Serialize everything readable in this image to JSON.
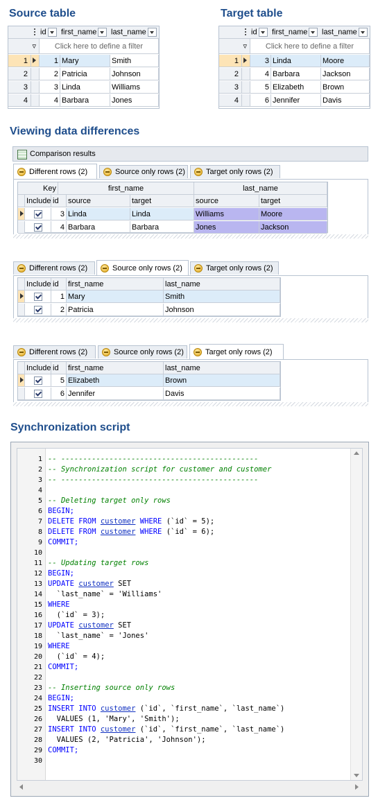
{
  "source_section": {
    "title": "Source table",
    "columns": [
      "id",
      "first_name",
      "last_name"
    ],
    "filter_text": "Click here to define a filter",
    "rows": [
      {
        "row": "1",
        "id": "1",
        "first_name": "Mary",
        "last_name": "Smith"
      },
      {
        "row": "2",
        "id": "2",
        "first_name": "Patricia",
        "last_name": "Johnson"
      },
      {
        "row": "3",
        "id": "3",
        "first_name": "Linda",
        "last_name": "Williams"
      },
      {
        "row": "4",
        "id": "4",
        "first_name": "Barbara",
        "last_name": "Jones"
      }
    ]
  },
  "target_section": {
    "title": "Target table",
    "columns": [
      "id",
      "first_name",
      "last_name"
    ],
    "filter_text": "Click here to define a filter",
    "rows": [
      {
        "row": "1",
        "id": "3",
        "first_name": "Linda",
        "last_name": "Moore"
      },
      {
        "row": "2",
        "id": "4",
        "first_name": "Barbara",
        "last_name": "Jackson"
      },
      {
        "row": "3",
        "id": "5",
        "first_name": "Elizabeth",
        "last_name": "Brown"
      },
      {
        "row": "4",
        "id": "6",
        "first_name": "Jennifer",
        "last_name": "Davis"
      }
    ]
  },
  "diff_section": {
    "title": "Viewing data differences",
    "panel_title": "Comparison results",
    "tabs": [
      "Different rows (2)",
      "Source only rows (2)",
      "Target only rows (2)"
    ],
    "different": {
      "group_headers": {
        "key": "Key",
        "first_name": "first_name",
        "last_name": "last_name"
      },
      "sub_headers": {
        "include": "Include",
        "id": "id",
        "source": "source",
        "target": "target"
      },
      "rows": [
        {
          "id": "3",
          "fn_source": "Linda",
          "fn_target": "Linda",
          "ln_source": "Williams",
          "ln_target": "Moore"
        },
        {
          "id": "4",
          "fn_source": "Barbara",
          "fn_target": "Barbara",
          "ln_source": "Jones",
          "ln_target": "Jackson"
        }
      ]
    },
    "source_only": {
      "headers": {
        "include": "Include",
        "id": "id",
        "first_name": "first_name",
        "last_name": "last_name"
      },
      "rows": [
        {
          "id": "1",
          "first_name": "Mary",
          "last_name": "Smith"
        },
        {
          "id": "2",
          "first_name": "Patricia",
          "last_name": "Johnson"
        }
      ]
    },
    "target_only": {
      "headers": {
        "include": "Include",
        "id": "id",
        "first_name": "first_name",
        "last_name": "last_name"
      },
      "rows": [
        {
          "id": "5",
          "first_name": "Elizabeth",
          "last_name": "Brown"
        },
        {
          "id": "6",
          "first_name": "Jennifer",
          "last_name": "Davis"
        }
      ]
    }
  },
  "sync_section": {
    "title": "Synchronization script",
    "lines": [
      {
        "n": "1",
        "parts": [
          [
            "cmt",
            "-- ---------------------------------------------"
          ]
        ]
      },
      {
        "n": "2",
        "parts": [
          [
            "cmt",
            "-- Synchronization script for customer and customer"
          ]
        ]
      },
      {
        "n": "3",
        "parts": [
          [
            "cmt",
            "-- ---------------------------------------------"
          ]
        ]
      },
      {
        "n": "4",
        "parts": []
      },
      {
        "n": "5",
        "parts": [
          [
            "cmt",
            "-- Deleting target only rows"
          ]
        ]
      },
      {
        "n": "6",
        "parts": [
          [
            "kw",
            "BEGIN;"
          ]
        ]
      },
      {
        "n": "7",
        "parts": [
          [
            "kw",
            "DELETE FROM "
          ],
          [
            "tbl",
            "customer"
          ],
          [
            "kw",
            " WHERE "
          ],
          [
            "str",
            "(`id` = 5);"
          ]
        ]
      },
      {
        "n": "8",
        "parts": [
          [
            "kw",
            "DELETE FROM "
          ],
          [
            "tbl",
            "customer"
          ],
          [
            "kw",
            " WHERE "
          ],
          [
            "str",
            "(`id` = 6);"
          ]
        ]
      },
      {
        "n": "9",
        "parts": [
          [
            "kw",
            "COMMIT;"
          ]
        ]
      },
      {
        "n": "10",
        "parts": []
      },
      {
        "n": "11",
        "parts": [
          [
            "cmt",
            "-- Updating target rows"
          ]
        ]
      },
      {
        "n": "12",
        "parts": [
          [
            "kw",
            "BEGIN;"
          ]
        ]
      },
      {
        "n": "13",
        "parts": [
          [
            "kw",
            "UPDATE "
          ],
          [
            "tbl",
            "customer"
          ],
          [
            "str",
            " SET"
          ]
        ]
      },
      {
        "n": "14",
        "parts": [
          [
            "str",
            "  `last_name` = 'Williams'"
          ]
        ]
      },
      {
        "n": "15",
        "parts": [
          [
            "kw",
            "WHERE"
          ]
        ]
      },
      {
        "n": "16",
        "parts": [
          [
            "str",
            "  (`id` = 3);"
          ]
        ]
      },
      {
        "n": "17",
        "parts": [
          [
            "kw",
            "UPDATE "
          ],
          [
            "tbl",
            "customer"
          ],
          [
            "str",
            " SET"
          ]
        ]
      },
      {
        "n": "18",
        "parts": [
          [
            "str",
            "  `last_name` = 'Jones'"
          ]
        ]
      },
      {
        "n": "19",
        "parts": [
          [
            "kw",
            "WHERE"
          ]
        ]
      },
      {
        "n": "20",
        "parts": [
          [
            "str",
            "  (`id` = 4);"
          ]
        ]
      },
      {
        "n": "21",
        "parts": [
          [
            "kw",
            "COMMIT;"
          ]
        ]
      },
      {
        "n": "22",
        "parts": []
      },
      {
        "n": "23",
        "parts": [
          [
            "cmt",
            "-- Inserting source only rows"
          ]
        ]
      },
      {
        "n": "24",
        "parts": [
          [
            "kw",
            "BEGIN;"
          ]
        ]
      },
      {
        "n": "25",
        "parts": [
          [
            "kw",
            "INSERT INTO "
          ],
          [
            "tbl",
            "customer"
          ],
          [
            "str",
            " (`id`, `first_name`, `last_name`)"
          ]
        ]
      },
      {
        "n": "26",
        "parts": [
          [
            "str",
            "  VALUES (1, 'Mary', 'Smith');"
          ]
        ]
      },
      {
        "n": "27",
        "parts": [
          [
            "kw",
            "INSERT INTO "
          ],
          [
            "tbl",
            "customer"
          ],
          [
            "str",
            " (`id`, `first_name`, `last_name`)"
          ]
        ]
      },
      {
        "n": "28",
        "parts": [
          [
            "str",
            "  VALUES (2, 'Patricia', 'Johnson');"
          ]
        ]
      },
      {
        "n": "29",
        "parts": [
          [
            "kw",
            "COMMIT;"
          ]
        ]
      },
      {
        "n": "30",
        "parts": []
      }
    ]
  }
}
